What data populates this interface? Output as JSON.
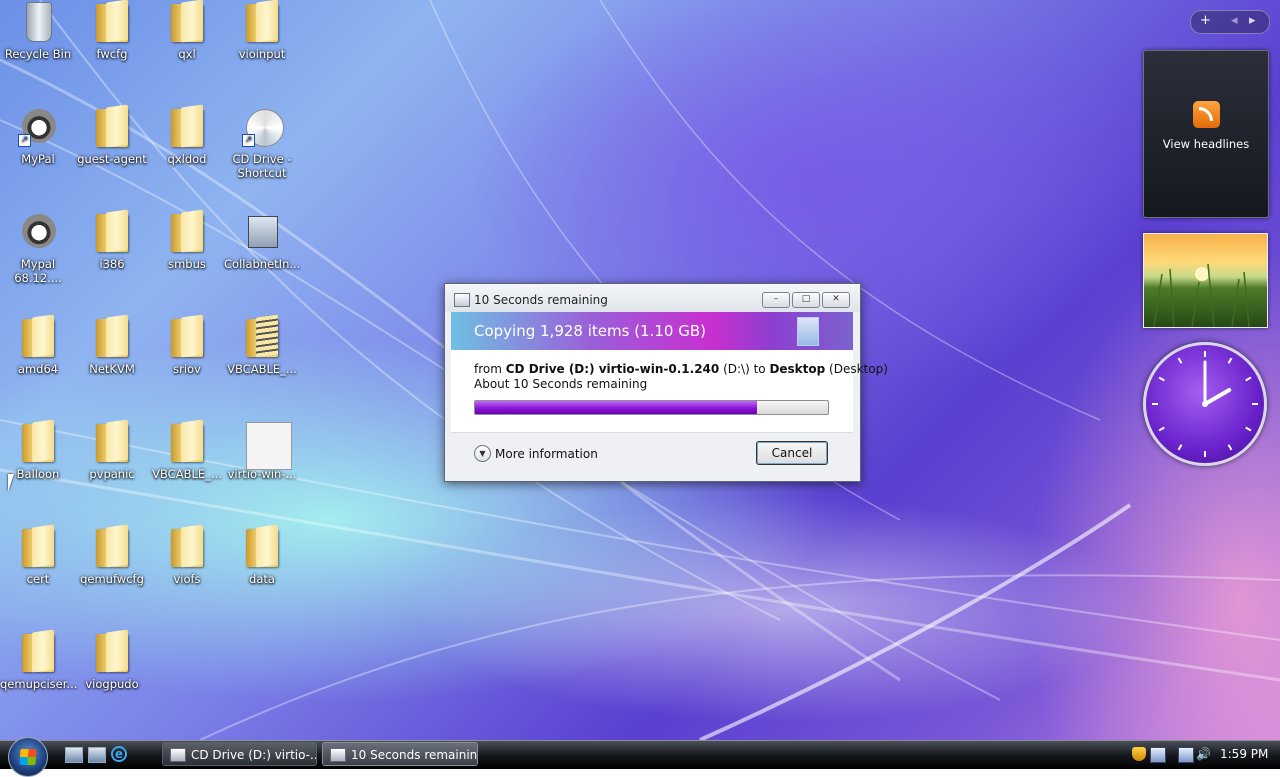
{
  "desktop": {
    "icons": [
      {
        "label": "Recycle Bin",
        "icon": "recycle-bin-icon"
      },
      {
        "label": "fwcfg",
        "icon": "folder-icon"
      },
      {
        "label": "qxl",
        "icon": "folder-icon"
      },
      {
        "label": "vioinput",
        "icon": "folder-icon"
      },
      {
        "label": "MyPal",
        "icon": "mypal-icon"
      },
      {
        "label": "guest-agent",
        "icon": "folder-icon"
      },
      {
        "label": "qxldod",
        "icon": "folder-icon"
      },
      {
        "label": "CD Drive - Shortcut",
        "icon": "cd-drive-shortcut-icon"
      },
      {
        "label": "Mypal 68.12....",
        "icon": "mypal-icon"
      },
      {
        "label": "i386",
        "icon": "folder-icon"
      },
      {
        "label": "smbus",
        "icon": "folder-icon"
      },
      {
        "label": "CollabnetIn...",
        "icon": "installer-icon"
      },
      {
        "label": "amd64",
        "icon": "folder-icon"
      },
      {
        "label": "NetKVM",
        "icon": "folder-icon"
      },
      {
        "label": "sriov",
        "icon": "folder-icon"
      },
      {
        "label": "VBCABLE_...",
        "icon": "zip-folder-icon"
      },
      {
        "label": "Balloon",
        "icon": "folder-icon"
      },
      {
        "label": "pvpanic",
        "icon": "folder-icon"
      },
      {
        "label": "VBCABLE_...",
        "icon": "folder-icon"
      },
      {
        "label": "virtio-win-...",
        "icon": "archive-icon"
      },
      {
        "label": "cert",
        "icon": "folder-icon"
      },
      {
        "label": "qemufwcfg",
        "icon": "folder-icon"
      },
      {
        "label": "viofs",
        "icon": "folder-icon"
      },
      {
        "label": "data",
        "icon": "folder-icon"
      },
      {
        "label": "qemupciser...",
        "icon": "folder-icon"
      },
      {
        "label": "viogpudo",
        "icon": "folder-icon"
      }
    ]
  },
  "sidebar": {
    "controls": {
      "add": "+",
      "prev": "◂",
      "next": "▸"
    },
    "rss_label": "View headlines",
    "clock": {
      "hour": 2,
      "minute": 0
    }
  },
  "dialog": {
    "title": "10 Seconds remaining",
    "minimize": "–",
    "maximize": "□",
    "close": "✕",
    "banner": "Copying 1,928 items (1.10 GB)",
    "from_prefix": "from ",
    "from_source": "CD Drive (D:) virtio-win-0.1.240",
    "from_source_path": " (D:\\) to ",
    "to_dest": "Desktop",
    "to_dest_path": " (Desktop)",
    "remaining": "About 10 Seconds remaining",
    "progress_fraction": 0.8,
    "more_info": "More information",
    "cancel": "Cancel"
  },
  "taskbar": {
    "tasks": [
      {
        "label": "CD Drive (D:) virtio-...",
        "active": false
      },
      {
        "label": "10 Seconds remaining",
        "active": true
      }
    ],
    "time": "1:59 PM"
  }
}
